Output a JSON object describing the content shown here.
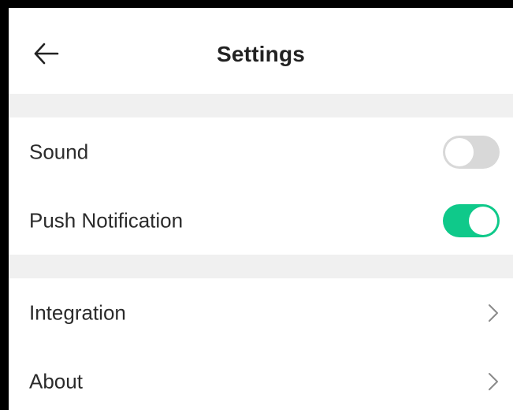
{
  "header": {
    "title": "Settings",
    "back_icon": "arrow-left-icon"
  },
  "sections": [
    {
      "items": [
        {
          "label": "Sound",
          "control": "toggle",
          "enabled": false
        },
        {
          "label": "Push Notification",
          "control": "toggle",
          "enabled": true
        }
      ]
    },
    {
      "items": [
        {
          "label": "Integration",
          "control": "chevron",
          "icon": "chevron-right-icon"
        },
        {
          "label": "About",
          "control": "chevron",
          "icon": "chevron-right-icon"
        }
      ]
    }
  ],
  "colors": {
    "toggle_on": "#0fc98a",
    "toggle_off": "#d8d8d8",
    "section_divider": "#f0f0f0"
  }
}
